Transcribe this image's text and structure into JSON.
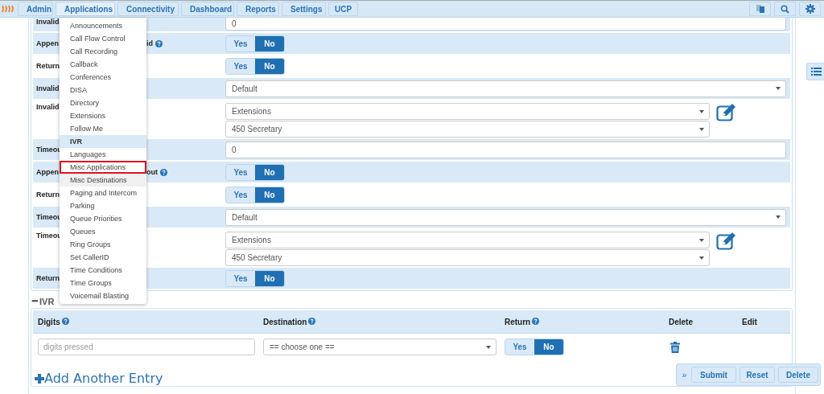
{
  "nav": {
    "tabs": [
      {
        "label": "Admin",
        "selected": false
      },
      {
        "label": "Applications",
        "selected": true
      },
      {
        "label": "Connectivity",
        "selected": false
      },
      {
        "label": "Dashboard",
        "selected": false
      },
      {
        "label": "Reports",
        "selected": false
      },
      {
        "label": "Settings",
        "selected": false
      },
      {
        "label": "UCP",
        "selected": false
      }
    ]
  },
  "applications_menu": [
    {
      "label": "Announcements",
      "selected": false,
      "hovered": false,
      "outlined": false
    },
    {
      "label": "Call Flow Control",
      "selected": false,
      "hovered": false,
      "outlined": false
    },
    {
      "label": "Call Recording",
      "selected": false,
      "hovered": false,
      "outlined": false
    },
    {
      "label": "Callback",
      "selected": false,
      "hovered": false,
      "outlined": false
    },
    {
      "label": "Conferences",
      "selected": false,
      "hovered": false,
      "outlined": false
    },
    {
      "label": "DISA",
      "selected": false,
      "hovered": false,
      "outlined": false
    },
    {
      "label": "Directory",
      "selected": false,
      "hovered": false,
      "outlined": false
    },
    {
      "label": "Extensions",
      "selected": false,
      "hovered": false,
      "outlined": false
    },
    {
      "label": "Follow Me",
      "selected": false,
      "hovered": false,
      "outlined": false
    },
    {
      "label": "IVR",
      "selected": true,
      "hovered": false,
      "outlined": false
    },
    {
      "label": "Languages",
      "selected": false,
      "hovered": false,
      "outlined": false
    },
    {
      "label": "Misc Applications",
      "selected": false,
      "hovered": false,
      "outlined": true
    },
    {
      "label": "Misc Destinations",
      "selected": false,
      "hovered": true,
      "outlined": false
    },
    {
      "label": "Paging and Intercom",
      "selected": false,
      "hovered": false,
      "outlined": false
    },
    {
      "label": "Parking",
      "selected": false,
      "hovered": false,
      "outlined": false
    },
    {
      "label": "Queue Priorities",
      "selected": false,
      "hovered": false,
      "outlined": false
    },
    {
      "label": "Queues",
      "selected": false,
      "hovered": false,
      "outlined": false
    },
    {
      "label": "Ring Groups",
      "selected": false,
      "hovered": false,
      "outlined": false
    },
    {
      "label": "Set CallerID",
      "selected": false,
      "hovered": false,
      "outlined": false
    },
    {
      "label": "Time Conditions",
      "selected": false,
      "hovered": false,
      "outlined": false
    },
    {
      "label": "Time Groups",
      "selected": false,
      "hovered": false,
      "outlined": false
    },
    {
      "label": "Voicemail Blasting",
      "selected": false,
      "hovered": false,
      "outlined": false
    }
  ],
  "form_rows": [
    {
      "kind": "input",
      "label": "Invalid",
      "shaded": true,
      "value": "0"
    },
    {
      "kind": "toggle",
      "label": "Appen",
      "label_end": "id",
      "help": true,
      "shaded": true,
      "options": [
        {
          "label": "Yes",
          "selected": false
        },
        {
          "label": "No",
          "selected": true
        }
      ]
    },
    {
      "kind": "toggle",
      "label": "Return",
      "shaded": false,
      "options": [
        {
          "label": "Yes",
          "selected": false
        },
        {
          "label": "No",
          "selected": true
        }
      ]
    },
    {
      "kind": "select",
      "label": "Invalid",
      "shaded": true,
      "value": "Default"
    },
    {
      "kind": "destination",
      "label": "Invalid",
      "shaded": false,
      "values": [
        "Extensions",
        "450 Secretary"
      ]
    },
    {
      "kind": "input",
      "label": "Timeou",
      "shaded": true,
      "value": "0"
    },
    {
      "kind": "toggle",
      "label": "Appen",
      "label_end": "out",
      "help": true,
      "shaded": true,
      "options": [
        {
          "label": "Yes",
          "selected": false
        },
        {
          "label": "No",
          "selected": true
        }
      ]
    },
    {
      "kind": "toggle",
      "label": "Return",
      "shaded": false,
      "options": [
        {
          "label": "Yes",
          "selected": false
        },
        {
          "label": "No",
          "selected": true
        }
      ]
    },
    {
      "kind": "select",
      "label": "Timeou",
      "shaded": true,
      "value": "Default"
    },
    {
      "kind": "destination",
      "label": "Timeou",
      "shaded": false,
      "values": [
        "Extensions",
        "450 Secretary"
      ]
    },
    {
      "kind": "toggle",
      "label": "Return",
      "shaded": true,
      "options": [
        {
          "label": "Yes",
          "selected": false
        },
        {
          "label": "No",
          "selected": true
        }
      ]
    }
  ],
  "entries_section": {
    "collapse_icon": "━",
    "title": "IVR",
    "columns": [
      {
        "label": "Digits",
        "help": true
      },
      {
        "label": "Destination",
        "help": true
      },
      {
        "label": "Return",
        "help": true
      },
      {
        "label": "Delete",
        "help": false
      },
      {
        "label": "Edit",
        "help": false
      }
    ],
    "row": {
      "digits_placeholder": "digits pressed",
      "destination": "== choose one ==",
      "return_options": [
        {
          "label": "Yes",
          "selected": false
        },
        {
          "label": "No",
          "selected": true
        }
      ]
    },
    "add_link": "Add Another Entry"
  },
  "action_bar": {
    "toggle": "»",
    "buttons": [
      "Submit",
      "Reset",
      "Delete"
    ]
  }
}
